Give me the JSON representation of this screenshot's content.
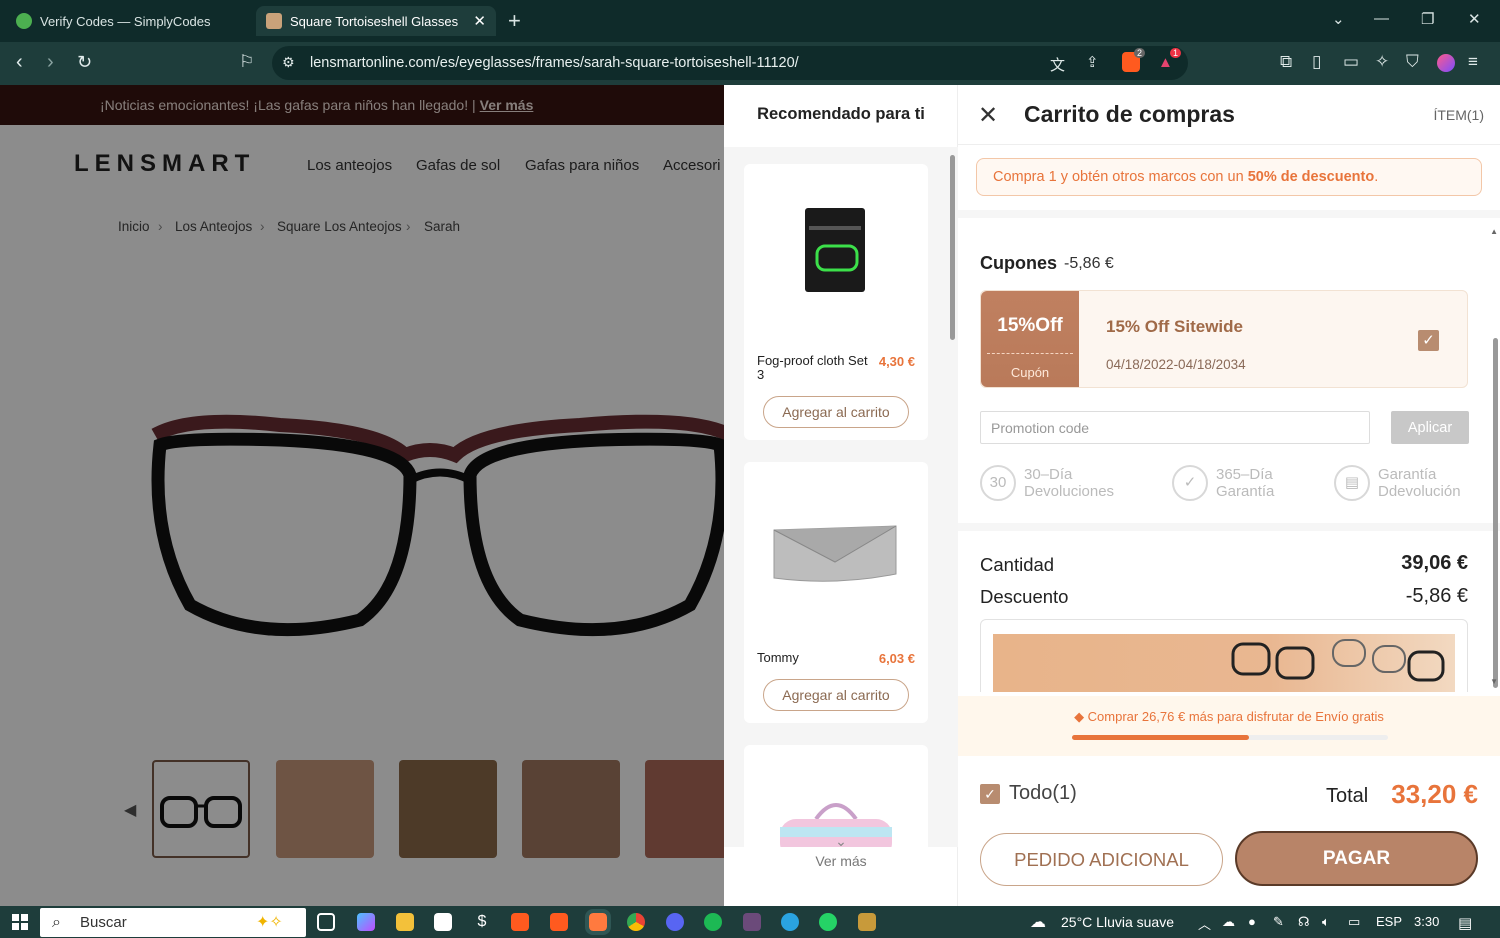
{
  "browser": {
    "tabs": [
      {
        "title": "Verify Codes — SimplyCodes"
      },
      {
        "title": "Square Tortoiseshell Glasses | S"
      }
    ],
    "url": "lensmartonline.com/es/eyeglasses/frames/sarah-square-tortoiseshell-11120/",
    "shield_badge": "2",
    "alert_badge": "1"
  },
  "page": {
    "notice_text": "¡Noticias emocionantes! ¡Las gafas para niños han llegado! |",
    "notice_link": "Ver más",
    "logo": "LENSMART",
    "nav": [
      "Los anteojos",
      "Gafas de sol",
      "Gafas para niños",
      "Accesori"
    ],
    "breadcrumb": [
      "Inicio",
      "Los Anteojos",
      "Square Los Anteojos",
      "Sarah"
    ]
  },
  "recommended": {
    "title": "Recomendado para ti",
    "items": [
      {
        "name": "Fog-proof cloth Set 3",
        "price": "4,30 €",
        "button": "Agregar al carrito"
      },
      {
        "name": "Tommy",
        "price": "6,03 €",
        "button": "Agregar al carrito"
      }
    ],
    "see_more": "Ver más"
  },
  "cart": {
    "title": "Carrito de compras",
    "item_count": "ÍTEM(1)",
    "promo_banner_prefix": "Compra 1 y obtén otros marcos con un ",
    "promo_banner_bold": "50% de descuento",
    "promo_banner_suffix": ".",
    "coupons_label": "Cupones",
    "coupons_amount": "-5,86 €",
    "coupon": {
      "badge": "15%Off",
      "type": "Cupón",
      "name": "15% Off Sitewide",
      "dates": "04/18/2022-04/18/2034",
      "checked": true
    },
    "promo_placeholder": "Promotion code",
    "apply_label": "Aplicar",
    "guarantees": [
      {
        "icon": "30",
        "line1": "30–Día",
        "line2": "Devoluciones"
      },
      {
        "icon": "shield",
        "line1": "365–Día",
        "line2": "Garantía"
      },
      {
        "icon": "wallet",
        "line1": "Garantía",
        "line2": "Ddevolución"
      }
    ],
    "quantity_label": "Cantidad",
    "quantity_value": "39,06 €",
    "discount_label": "Descuento",
    "discount_value": "-5,86 €",
    "shipping_text": "Comprar 26,76 € más para disfrutar de Envío gratis",
    "shipping_progress": 0.56,
    "select_all_label": "Todo(1)",
    "total_label": "Total",
    "total_value": "33,20 €",
    "extra_order_button": "PEDIDO ADICIONAL",
    "pay_button": "PAGAR"
  },
  "taskbar": {
    "search_label": "Buscar",
    "weather": "25°C  Lluvia suave",
    "language": "ESP",
    "time": "3:30"
  },
  "colors": {
    "accent": "#e8743b",
    "brown": "#b88468",
    "chrome": "#1e3d3b"
  }
}
